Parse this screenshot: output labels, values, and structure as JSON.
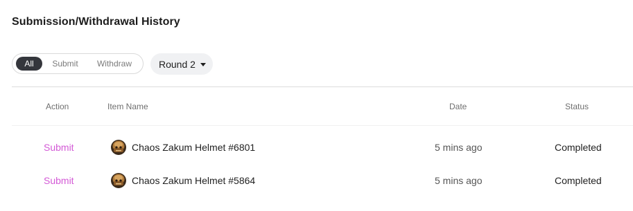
{
  "page": {
    "title": "Submission/Withdrawal History"
  },
  "filters": {
    "tabs": [
      {
        "label": "All",
        "active": true
      },
      {
        "label": "Submit",
        "active": false
      },
      {
        "label": "Withdraw",
        "active": false
      }
    ],
    "round": {
      "label": "Round 2",
      "icon": "caret-down-icon"
    }
  },
  "table": {
    "headers": {
      "action": "Action",
      "item_name": "Item Name",
      "date": "Date",
      "status": "Status"
    },
    "rows": [
      {
        "action": "Submit",
        "item_icon": "helmet-icon",
        "item_name": "Chaos Zakum Helmet #6801",
        "date": "5 mins ago",
        "status": "Completed"
      },
      {
        "action": "Submit",
        "item_icon": "helmet-icon",
        "item_name": "Chaos Zakum Helmet #5864",
        "date": "5 mins ago",
        "status": "Completed"
      }
    ]
  },
  "colors": {
    "accent_link": "#d35ad6",
    "active_tab_bg": "#34363c",
    "dropdown_bg": "#f0f1f3"
  }
}
